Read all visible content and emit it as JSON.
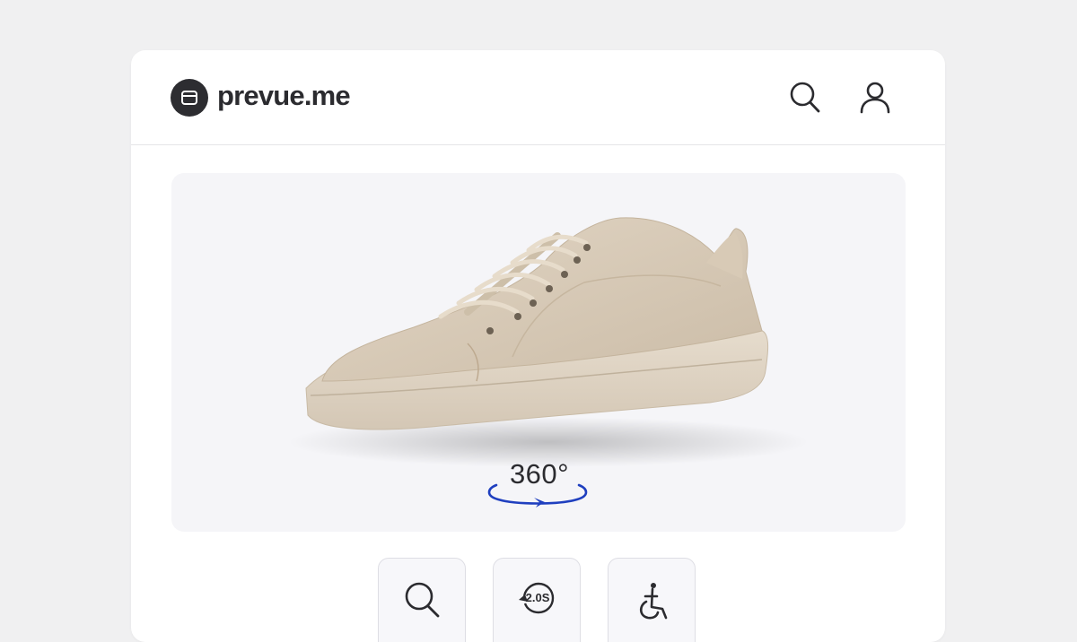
{
  "header": {
    "brand": "prevue.me",
    "logo_icon": "card-icon",
    "search_icon": "search-icon",
    "account_icon": "user-icon"
  },
  "viewer": {
    "product_image": "beige low-top sneaker",
    "rotation_label": "360°",
    "rotation_icon": "rotate-arrow-icon",
    "accent_color": "#1f3fbf"
  },
  "tools": [
    {
      "icon": "zoom-icon"
    },
    {
      "icon": "replay-icon",
      "label": "2.0S"
    },
    {
      "icon": "accessibility-icon"
    }
  ]
}
